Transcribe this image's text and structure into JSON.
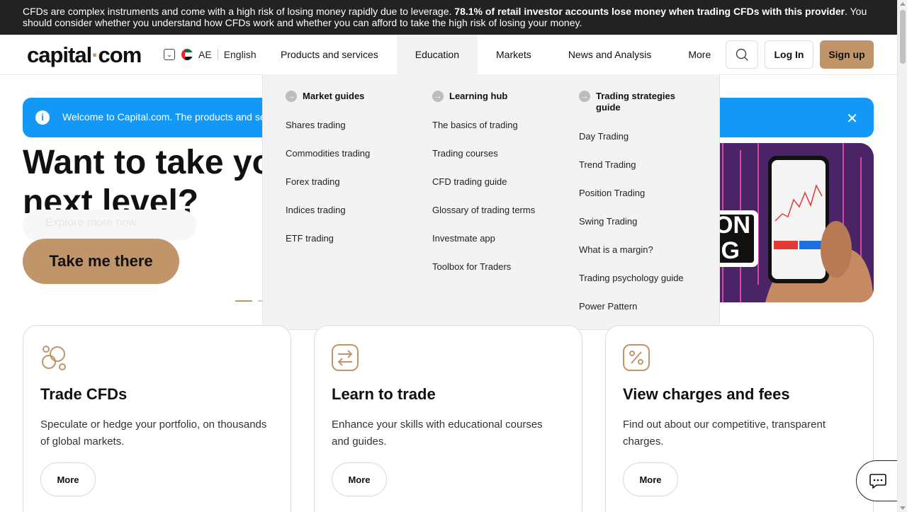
{
  "risk_banner": {
    "text_start": "CFDs are complex instruments and come with a high risk of losing money rapidly due to leverage. ",
    "text_bold": "78.1% of retail investor accounts lose money when trading CFDs with this provider",
    "text_end": ". You should consider whether you understand how CFDs work and whether you can afford to take the high risk of losing your money."
  },
  "header": {
    "logo_part1": "capital",
    "logo_dot": "·",
    "logo_part2": "com",
    "region_code": "AE",
    "language": "English",
    "nav": {
      "products": "Products and services",
      "education": "Education",
      "markets": "Markets",
      "news": "News and Analysis",
      "more": "More"
    },
    "login": "Log In",
    "signup": "Sign up"
  },
  "welcome": {
    "text": "Welcome to Capital.com. The products and serv",
    "close": "✕"
  },
  "hero": {
    "title": "Want to take yo the next level?",
    "subtitle": "Explore more now",
    "button": "Take me there"
  },
  "dropdown": {
    "col1": {
      "heading": "Market guides",
      "items": [
        "Shares trading",
        "Commodities trading",
        "Forex trading",
        "Indices trading",
        "ETF trading"
      ]
    },
    "col2": {
      "heading": "Learning hub",
      "items": [
        "The basics of trading",
        "Trading courses",
        "CFD trading guide",
        "Glossary of trading terms",
        "Investmate app",
        "Toolbox for Traders"
      ]
    },
    "col3": {
      "heading": "Trading strategies guide",
      "items": [
        "Day Trading",
        "Trend Trading",
        "Position Trading",
        "Swing Trading",
        "What is a margin?",
        "Trading psychology guide",
        "Power Pattern"
      ]
    }
  },
  "cards": [
    {
      "title": "Trade CFDs",
      "desc": "Speculate or hedge your portfolio, on thousands of global markets.",
      "button": "More"
    },
    {
      "title": "Learn to trade",
      "desc": "Enhance your skills with educational courses and guides.",
      "button": "More"
    },
    {
      "title": "View charges and fees",
      "desc": "Find out about our competitive, transparent charges.",
      "button": "More"
    }
  ],
  "colors": {
    "accent": "#c0956a",
    "banner": "#222222",
    "info": "#1498f5"
  }
}
